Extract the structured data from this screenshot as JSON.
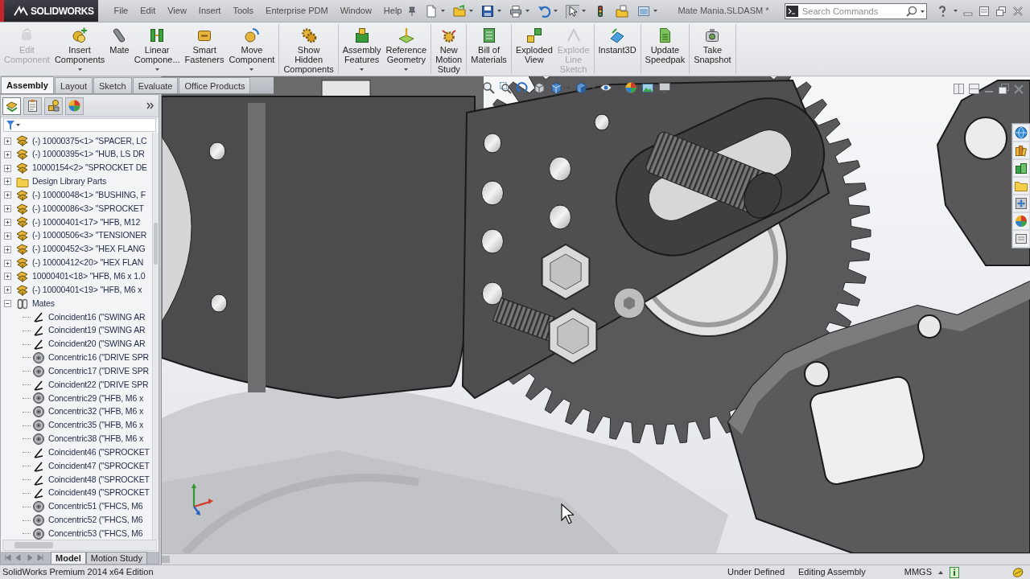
{
  "app": {
    "name": "SOLIDWORKS"
  },
  "menu": [
    "File",
    "Edit",
    "View",
    "Insert",
    "Tools",
    "Enterprise PDM",
    "Window",
    "Help"
  ],
  "quick_access": [
    {
      "kind": "new",
      "dropdown": true,
      "pressed": false
    },
    {
      "kind": "open",
      "dropdown": true,
      "pressed": false
    },
    {
      "kind": "save",
      "dropdown": true,
      "pressed": false
    },
    {
      "kind": "print",
      "dropdown": true,
      "pressed": false
    },
    {
      "kind": "undo",
      "dropdown": true,
      "pressed": false
    },
    {
      "kind": "select",
      "dropdown": true,
      "pressed": true
    },
    {
      "kind": "rebuild",
      "dropdown": false,
      "pressed": false
    },
    {
      "kind": "properties",
      "dropdown": false,
      "pressed": false
    },
    {
      "kind": "options",
      "dropdown": true,
      "pressed": false
    }
  ],
  "document_title": "Mate Mania.SLDASM *",
  "search": {
    "placeholder": "Search Commands"
  },
  "ribbon": {
    "groups": [
      [
        {
          "kind": "edit",
          "label": "Edit\nComponent",
          "disabled": true,
          "dropdown": false
        },
        {
          "kind": "insert",
          "label": "Insert\nComponents",
          "disabled": false,
          "dropdown": true
        },
        {
          "kind": "mate",
          "label": "Mate",
          "disabled": false,
          "dropdown": false
        },
        {
          "kind": "pattern",
          "label": "Linear\nCompone...",
          "disabled": false,
          "dropdown": true
        },
        {
          "kind": "fastener",
          "label": "Smart\nFasteners",
          "disabled": false,
          "dropdown": false
        },
        {
          "kind": "move",
          "label": "Move\nComponent",
          "disabled": false,
          "dropdown": true
        }
      ],
      [
        {
          "kind": "show",
          "label": "Show\nHidden\nComponents",
          "disabled": false,
          "dropdown": false
        }
      ],
      [
        {
          "kind": "feature",
          "label": "Assembly\nFeatures",
          "disabled": false,
          "dropdown": true
        },
        {
          "kind": "reference",
          "label": "Reference\nGeometry",
          "disabled": false,
          "dropdown": true
        }
      ],
      [
        {
          "kind": "motion",
          "label": "New\nMotion\nStudy",
          "disabled": false,
          "dropdown": false
        }
      ],
      [
        {
          "kind": "bom",
          "label": "Bill of\nMaterials",
          "disabled": false,
          "dropdown": false
        }
      ],
      [
        {
          "kind": "explode",
          "label": "Exploded\nView",
          "disabled": false,
          "dropdown": false
        },
        {
          "kind": "sketch",
          "label": "Explode\nLine\nSketch",
          "disabled": true,
          "dropdown": false
        }
      ],
      [
        {
          "kind": "instant3d",
          "label": "Instant3D",
          "disabled": false,
          "dropdown": false
        }
      ],
      [
        {
          "kind": "speedpak",
          "label": "Update\nSpeedpak",
          "disabled": false,
          "dropdown": false
        }
      ],
      [
        {
          "kind": "snapshot",
          "label": "Take\nSnapshot",
          "disabled": false,
          "dropdown": false
        }
      ]
    ]
  },
  "tabs": [
    {
      "label": "Assembly",
      "selected": true
    },
    {
      "label": "Layout",
      "selected": false
    },
    {
      "label": "Sketch",
      "selected": false
    },
    {
      "label": "Evaluate",
      "selected": false
    },
    {
      "label": "Office Products",
      "selected": false
    }
  ],
  "panel_tabs": [
    {
      "kind": "tree",
      "selected": true
    },
    {
      "kind": "property",
      "selected": false
    },
    {
      "kind": "configuration",
      "selected": false
    },
    {
      "kind": "display",
      "selected": false
    }
  ],
  "feature_tree": {
    "items": [
      {
        "kind": "component",
        "label": "(-) 10000375<1> \"SPACER, LC",
        "expanded": false
      },
      {
        "kind": "component",
        "label": "(-) 10000395<1> \"HUB, LS DR",
        "expanded": false
      },
      {
        "kind": "component",
        "label": "10000154<2> \"SPROCKET DE",
        "expanded": false
      },
      {
        "kind": "folder",
        "label": "Design Library Parts",
        "expanded": false
      },
      {
        "kind": "component",
        "label": "(-) 10000048<1> \"BUSHING, F",
        "expanded": false
      },
      {
        "kind": "component",
        "label": "(-) 10000086<3> \"SPROCKET",
        "expanded": false
      },
      {
        "kind": "component",
        "label": "(-) 10000401<17> \"HFB, M12",
        "expanded": false
      },
      {
        "kind": "component",
        "label": "(-) 10000506<3> \"TENSIONER",
        "expanded": false
      },
      {
        "kind": "component",
        "label": "(-) 10000452<3> \"HEX FLANG",
        "expanded": false
      },
      {
        "kind": "component",
        "label": "(-) 10000412<20> \"HEX FLAN",
        "expanded": false
      },
      {
        "kind": "component",
        "label": "10000401<18> \"HFB, M6 x 1.0",
        "expanded": false
      },
      {
        "kind": "component",
        "label": "(-) 10000401<19> \"HFB, M6 x",
        "expanded": false
      },
      {
        "kind": "mates",
        "label": "Mates",
        "expanded": true,
        "children": [
          {
            "kind": "coincident",
            "label": "Coincident16 (\"SWING AR"
          },
          {
            "kind": "coincident",
            "label": "Coincident19 (\"SWING AR"
          },
          {
            "kind": "coincident",
            "label": "Coincident20 (\"SWING AR"
          },
          {
            "kind": "concentric",
            "label": "Concentric16 (\"DRIVE SPR"
          },
          {
            "kind": "concentric",
            "label": "Concentric17 (\"DRIVE SPR"
          },
          {
            "kind": "coincident",
            "label": "Coincident22 (\"DRIVE SPR"
          },
          {
            "kind": "concentric",
            "label": "Concentric29 (\"HFB, M6 x"
          },
          {
            "kind": "concentric",
            "label": "Concentric32 (\"HFB, M6 x"
          },
          {
            "kind": "concentric",
            "label": "Concentric35 (\"HFB, M6 x"
          },
          {
            "kind": "concentric",
            "label": "Concentric38 (\"HFB, M6 x"
          },
          {
            "kind": "coincident",
            "label": "Coincident46 (\"SPROCKET"
          },
          {
            "kind": "coincident",
            "label": "Coincident47 (\"SPROCKET"
          },
          {
            "kind": "coincident",
            "label": "Coincident48 (\"SPROCKET"
          },
          {
            "kind": "coincident",
            "label": "Coincident49 (\"SPROCKET"
          },
          {
            "kind": "concentric",
            "label": "Concentric51 (\"FHCS, M6"
          },
          {
            "kind": "concentric",
            "label": "Concentric52 (\"FHCS, M6"
          },
          {
            "kind": "concentric",
            "label": "Concentric53 (\"FHCS, M6"
          }
        ]
      }
    ]
  },
  "bottom_tabs": [
    {
      "label": "Model",
      "selected": true
    },
    {
      "label": "Motion Study",
      "selected": false
    }
  ],
  "status_bar": {
    "product": "SolidWorks Premium 2014 x64 Edition",
    "state": "Under Defined",
    "mode": "Editing Assembly",
    "units": "MMGS"
  }
}
